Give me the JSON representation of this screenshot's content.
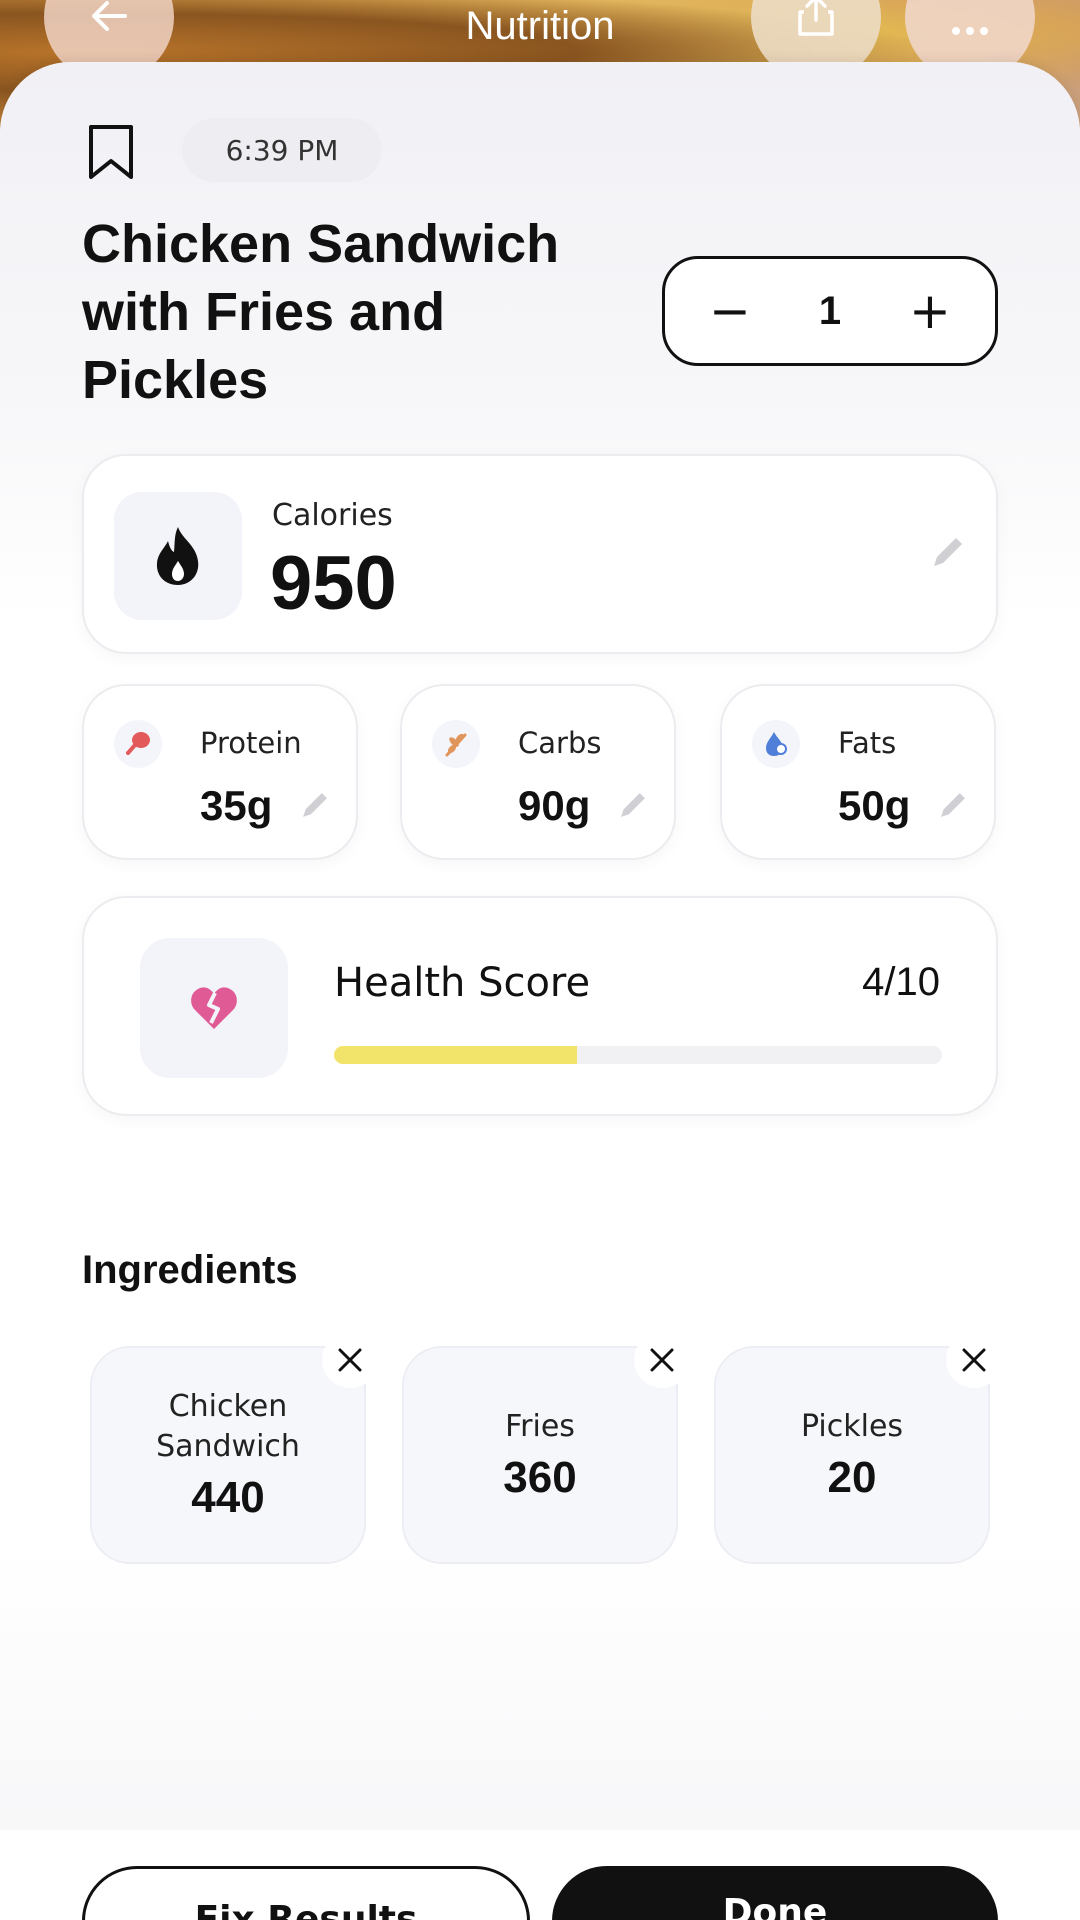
{
  "header": {
    "title": "Nutrition",
    "back_icon": "arrow-left-icon",
    "share_icon": "share-icon",
    "more_icon": "more-icon"
  },
  "meal": {
    "time": "6:39 PM",
    "title": "Chicken Sandwich with Fries and Pickles",
    "quantity": "1",
    "decrement": "−",
    "increment": "+"
  },
  "calories": {
    "label": "Calories",
    "value": "950",
    "icon": "flame-icon"
  },
  "macros": [
    {
      "label": "Protein",
      "value": "35g",
      "icon": "drumstick-icon",
      "color": "#e35a5a"
    },
    {
      "label": "Carbs",
      "value": "90g",
      "icon": "wheat-icon",
      "color": "#e0955a"
    },
    {
      "label": "Fats",
      "value": "50g",
      "icon": "drop-icon",
      "color": "#4f7fd9"
    }
  ],
  "health": {
    "label": "Health Score",
    "value": "4/10",
    "score": 4,
    "max": 10,
    "icon": "broken-heart-icon",
    "bar_color": "#f2e46a"
  },
  "ingredients": {
    "heading": "Ingredients",
    "items": [
      {
        "name": "Chicken Sandwich",
        "calories": "440"
      },
      {
        "name": "Fries",
        "calories": "360"
      },
      {
        "name": "Pickles",
        "calories": "20"
      }
    ]
  },
  "actions": {
    "fix_label": "Fix Results",
    "done_label": "Done"
  }
}
